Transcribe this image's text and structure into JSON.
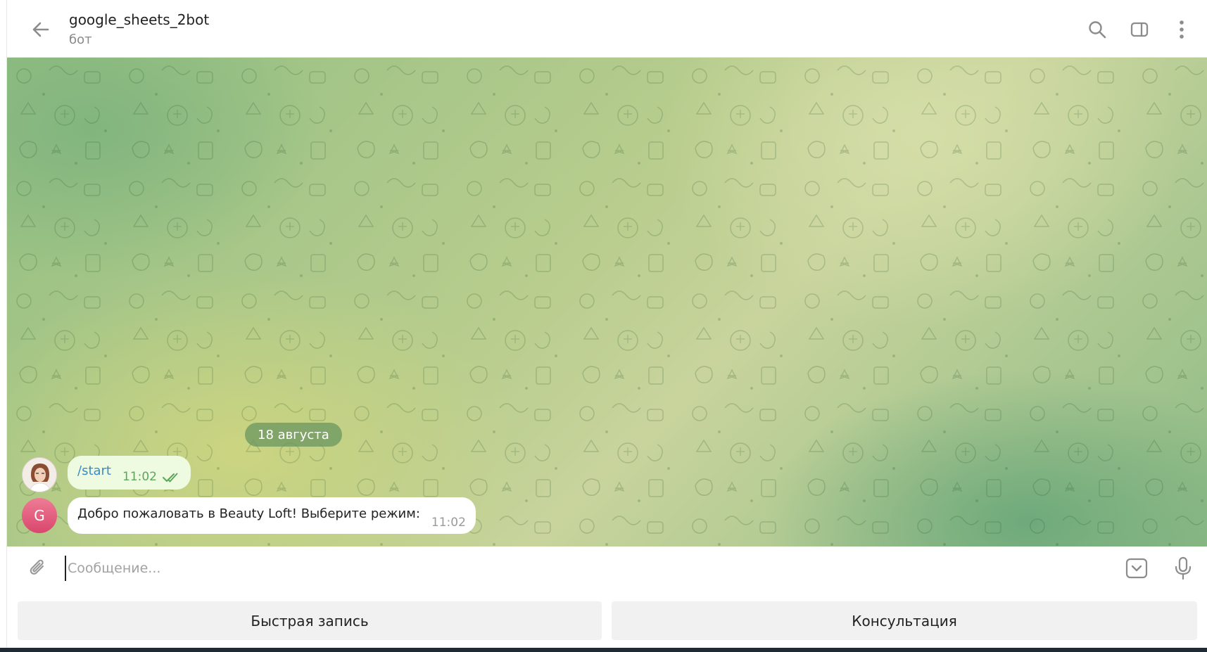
{
  "header": {
    "title": "google_sheets_2bot",
    "subtitle": "бот",
    "back_icon": "arrow-left-icon",
    "search_icon": "search-icon",
    "sidebar_toggle_icon": "sidebar-toggle-icon",
    "more_icon": "more-vertical-icon"
  },
  "chat": {
    "date_separator": "18 августа",
    "messages": [
      {
        "direction": "outgoing",
        "text": "/start",
        "time": "11:02",
        "status": "read",
        "avatar": "user-photo"
      },
      {
        "direction": "incoming",
        "text": "Добро пожаловать в Beauty Loft! Выберите режим:",
        "time": "11:02",
        "avatar_letter": "G"
      }
    ]
  },
  "composer": {
    "placeholder": "Сообщение...",
    "value": "",
    "attach_icon": "paperclip-icon",
    "keyboard_toggle_icon": "keyboard-toggle-icon",
    "mic_icon": "microphone-icon"
  },
  "keyboard": {
    "buttons": [
      {
        "label": "Быстрая запись"
      },
      {
        "label": "Консультация"
      }
    ]
  },
  "colors": {
    "outgoing_bubble": "#eefbe0",
    "incoming_bubble": "#ffffff",
    "link": "#3a8cc7",
    "read_ticks": "#5ba65b",
    "bot_avatar": "#e05a7b"
  }
}
